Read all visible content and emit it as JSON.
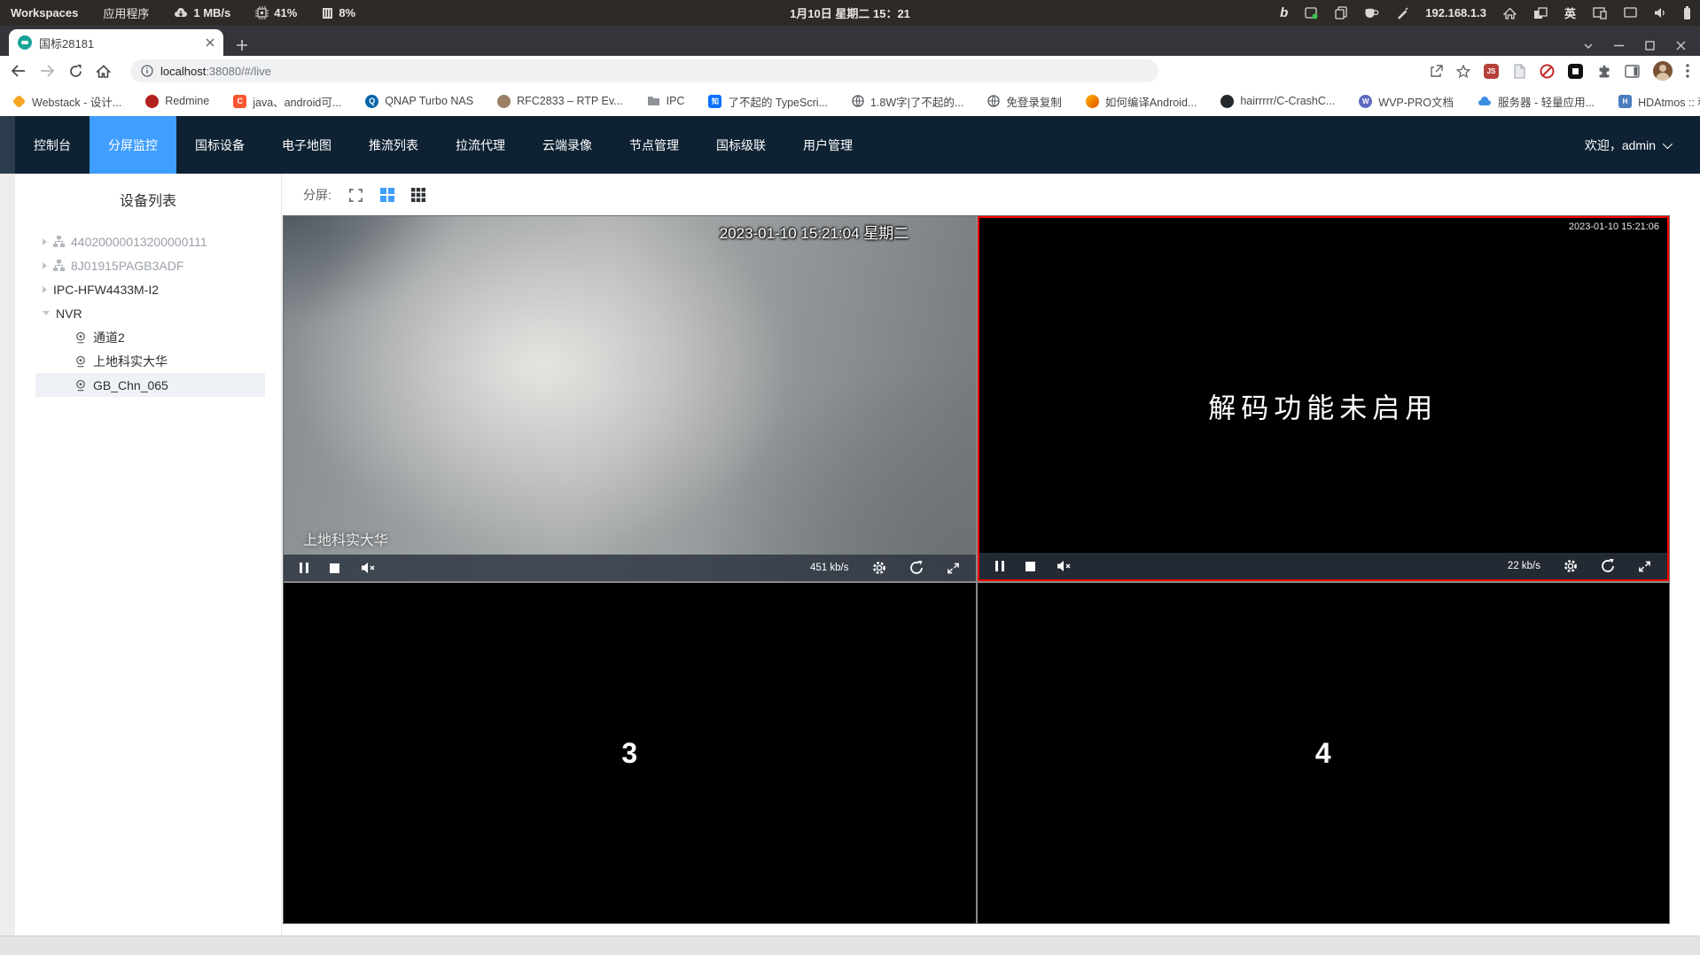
{
  "system_bar": {
    "workspaces": "Workspaces",
    "applications": "应用程序",
    "network_speed": "1 MB/s",
    "cpu": "41%",
    "memory": "8%",
    "clock": "1月10日 星期二 15：21",
    "ip": "192.168.1.3",
    "ime": "英",
    "bing_glyph": "b"
  },
  "browser": {
    "tab_title": "国标28181",
    "url_host": "localhost",
    "url_rest": ":38080/#/live",
    "extensions": {
      "js": "JS"
    },
    "overflow": "»",
    "bookmarks": [
      {
        "label": "Webstack - 设计..."
      },
      {
        "label": "Redmine"
      },
      {
        "label": "java、android可...",
        "glyph": "C"
      },
      {
        "label": "QNAP Turbo NAS",
        "glyph": "Q"
      },
      {
        "label": "RFC2833 – RTP Ev..."
      },
      {
        "label": "IPC"
      },
      {
        "label": "了不起的 TypeScri...",
        "glyph": "知"
      },
      {
        "label": "1.8W字|了不起的..."
      },
      {
        "label": "免登录复制"
      },
      {
        "label": "如何编译Android..."
      },
      {
        "label": "hairrrrr/C-CrashC..."
      },
      {
        "label": "WVP-PRO文档",
        "glyph": "W"
      },
      {
        "label": "服务器 - 轻量应用..."
      },
      {
        "label": "HDAtmos :: 种子 *...",
        "glyph": "H"
      }
    ]
  },
  "nav": {
    "items": [
      {
        "label": "控制台"
      },
      {
        "label": "分屏监控",
        "active": true
      },
      {
        "label": "国标设备"
      },
      {
        "label": "电子地图"
      },
      {
        "label": "推流列表"
      },
      {
        "label": "拉流代理"
      },
      {
        "label": "云端录像"
      },
      {
        "label": "节点管理"
      },
      {
        "label": "国标级联"
      },
      {
        "label": "用户管理"
      }
    ],
    "welcome": "欢迎，admin"
  },
  "sidebar": {
    "title": "设备列表",
    "devices": [
      {
        "name": "44020000013200000111",
        "offline": true
      },
      {
        "name": "8J01915PAGB3ADF",
        "offline": true
      },
      {
        "name": "IPC-HFW4433M-I2"
      },
      {
        "name": "NVR",
        "expanded": true,
        "children": [
          {
            "name": "通道2"
          },
          {
            "name": "上地科实大华"
          },
          {
            "name": "GB_Chn_065",
            "selected": true
          }
        ]
      }
    ]
  },
  "toolbar": {
    "split_label": "分屏:"
  },
  "grid": {
    "cell1": {
      "timestamp": "2023-01-10 15:21:04 星期二",
      "label": "上地科实大华",
      "bitrate": "451 kb/s"
    },
    "cell2": {
      "timestamp": "2023-01-10 15:21:06",
      "message": "解码功能未启用",
      "bitrate": "22 kb/s"
    },
    "cell3": {
      "number": "3"
    },
    "cell4": {
      "number": "4"
    }
  },
  "colors": {
    "accent": "#409eff",
    "nav_bg": "#0e2233",
    "selected_border": "#fb0000"
  }
}
